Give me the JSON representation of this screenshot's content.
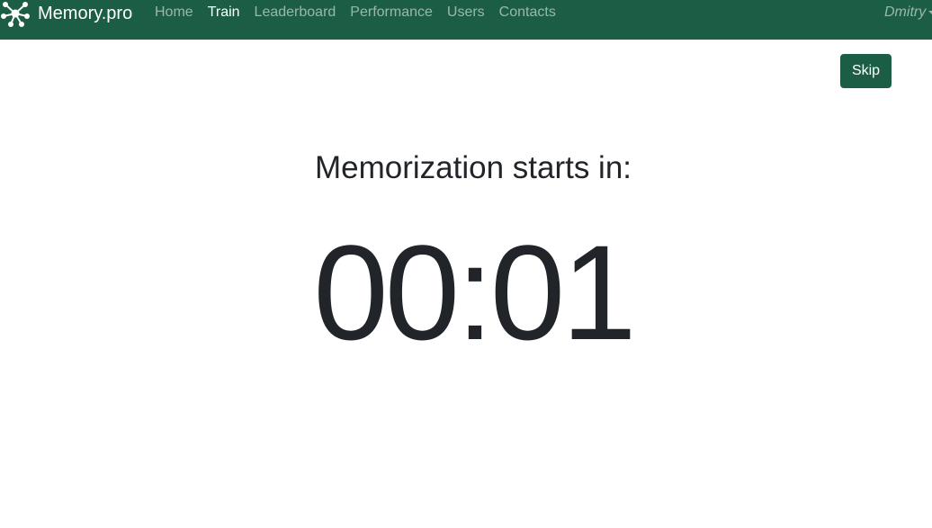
{
  "navbar": {
    "brand": "Memory.pro",
    "brand_icon": "molecule-network-icon",
    "links": [
      {
        "label": "Home",
        "active": false
      },
      {
        "label": "Train",
        "active": true
      },
      {
        "label": "Leaderboard",
        "active": false
      },
      {
        "label": "Performance",
        "active": false
      },
      {
        "label": "Users",
        "active": false
      },
      {
        "label": "Contacts",
        "active": false
      }
    ],
    "user": "Dmitry",
    "background_color": "#1b5e45"
  },
  "actions": {
    "skip_label": "Skip"
  },
  "countdown": {
    "heading": "Memorization starts in:",
    "time": "00:01"
  }
}
